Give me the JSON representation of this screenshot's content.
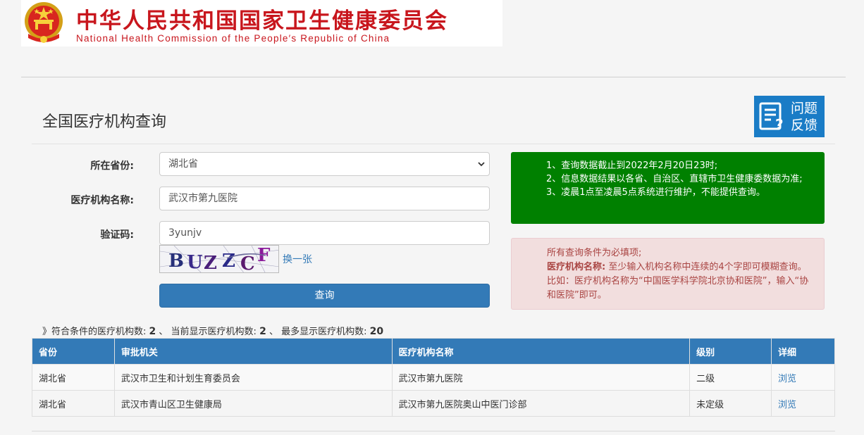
{
  "header": {
    "title_cn": "中华人民共和国国家卫生健康委员会",
    "title_en": "National Health Commission of the People′s Republic of China"
  },
  "page": {
    "title": "全国医疗机构查询",
    "feedback": "问题\n反馈"
  },
  "form": {
    "province_label": "所在省份:",
    "province_value": "湖北省",
    "name_label": "医疗机构名称:",
    "name_value": "武汉市第九医院",
    "captcha_label": "验证码:",
    "captcha_value": "3yunjv",
    "captcha_image_text": "BUZZCF",
    "refresh_label": "换一张",
    "submit_label": "查询"
  },
  "notice_info": {
    "lines": [
      "1、查询数据截止到2022年2月20日23时;",
      "2、信息数据结果以各省、自治区、直辖市卫生健康委数据为准;",
      "3、凌晨1点至凌晨5点系统进行维护，不能提供查询。"
    ]
  },
  "notice_warning": {
    "line1": "所有查询条件为必填项;",
    "label": "医疗机构名称:",
    "line2": "至少输入机构名称中连续的4个字即可模糊查询。比如：医疗机构名称为“中国医学科学院北京协和医院”，输入“协和医院”即可。"
  },
  "summary": {
    "prefix": "》符合条件的医疗机构数:",
    "match_count": "2",
    "sep1": "、 当前显示医疗机构数:",
    "shown_count": "2",
    "sep2": "、 最多显示医疗机构数:",
    "max_count": "20"
  },
  "table": {
    "headers": [
      "省份",
      "审批机关",
      "医疗机构名称",
      "级别",
      "详细"
    ],
    "rows": [
      [
        "湖北省",
        "武汉市卫生和计划生育委员会",
        "武汉市第九医院",
        "二级",
        "浏览"
      ],
      [
        "湖北省",
        "武汉市青山区卫生健康局",
        "武汉市第九医院奥山中医门诊部",
        "未定级",
        "浏览"
      ]
    ]
  },
  "colors": {
    "brand_red": "#c8161d",
    "primary_blue": "#337ab7",
    "info_green": "#008000",
    "warning_bg": "#f2dede",
    "warning_text": "#a94442"
  },
  "icons": {
    "emblem": "national-emblem-icon",
    "feedback": "feedback-form-icon",
    "select": "chevron-down-icon"
  }
}
